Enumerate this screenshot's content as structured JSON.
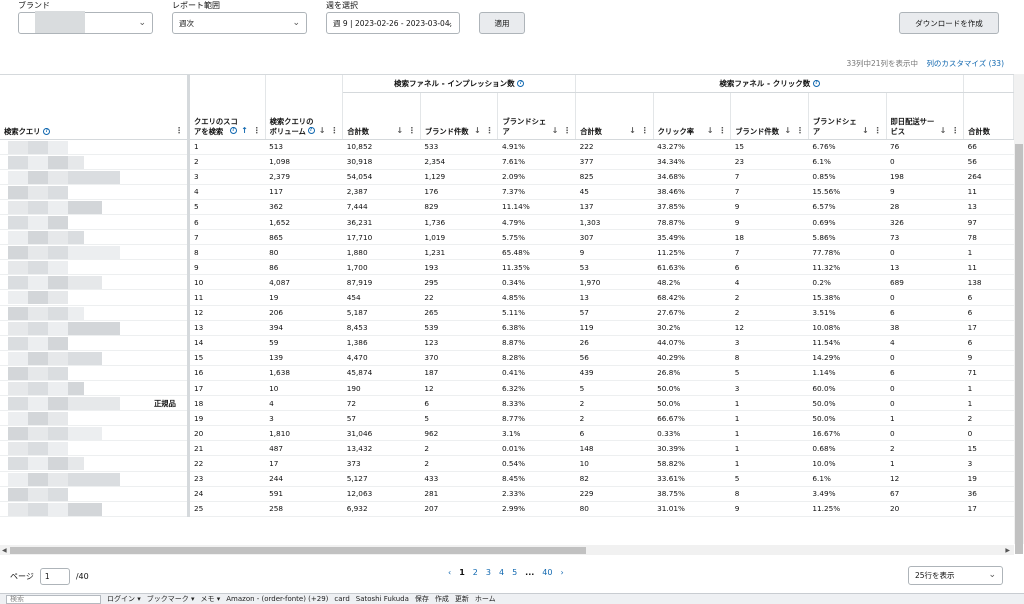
{
  "filters": {
    "brand_label": "ブランド",
    "report_range_label": "レポート範囲",
    "report_range_value": "週次",
    "week_label": "週を選択",
    "week_value": "週 9 | 2023-02-26 - 2023-03-04,",
    "apply_button": "適用",
    "download_button": "ダウンロードを作成"
  },
  "infobar": {
    "text": "33列中21列を表示中",
    "customize_link": "列のカスタマイズ (33)"
  },
  "table": {
    "group_headers": [
      "検索ファネル - インプレッション数",
      "検索ファネル - クリック数"
    ],
    "col_query": "検索クエリ",
    "col_score": "クエリのスコアを検索",
    "col_volume": "検索クエリのボリューム",
    "col_imp_total": "合計数",
    "col_imp_brand_count": "ブランド件数",
    "col_imp_brand_share": "ブランドシェア",
    "col_clk_total": "合計数",
    "col_clk_rate": "クリック率",
    "col_clk_brand_count": "ブランド件数",
    "col_clk_brand_share": "ブランドシェア",
    "col_sameday": "即日配送サービス",
    "col_total_next": "合計数",
    "tag_text": "正規品",
    "rows": [
      [
        "1",
        "513",
        "10,852",
        "533",
        "4.91%",
        "222",
        "43.27%",
        "15",
        "6.76%",
        "76",
        "66"
      ],
      [
        "2",
        "1,098",
        "30,918",
        "2,354",
        "7.61%",
        "377",
        "34.34%",
        "23",
        "6.1%",
        "0",
        "56"
      ],
      [
        "3",
        "2,379",
        "54,054",
        "1,129",
        "2.09%",
        "825",
        "34.68%",
        "7",
        "0.85%",
        "198",
        "264"
      ],
      [
        "4",
        "117",
        "2,387",
        "176",
        "7.37%",
        "45",
        "38.46%",
        "7",
        "15.56%",
        "9",
        "11"
      ],
      [
        "5",
        "362",
        "7,444",
        "829",
        "11.14%",
        "137",
        "37.85%",
        "9",
        "6.57%",
        "28",
        "13"
      ],
      [
        "6",
        "1,652",
        "36,231",
        "1,736",
        "4.79%",
        "1,303",
        "78.87%",
        "9",
        "0.69%",
        "326",
        "97"
      ],
      [
        "7",
        "865",
        "17,710",
        "1,019",
        "5.75%",
        "307",
        "35.49%",
        "18",
        "5.86%",
        "73",
        "78"
      ],
      [
        "8",
        "80",
        "1,880",
        "1,231",
        "65.48%",
        "9",
        "11.25%",
        "7",
        "77.78%",
        "0",
        "1"
      ],
      [
        "9",
        "86",
        "1,700",
        "193",
        "11.35%",
        "53",
        "61.63%",
        "6",
        "11.32%",
        "13",
        "11"
      ],
      [
        "10",
        "4,087",
        "87,919",
        "295",
        "0.34%",
        "1,970",
        "48.2%",
        "4",
        "0.2%",
        "689",
        "138"
      ],
      [
        "11",
        "19",
        "454",
        "22",
        "4.85%",
        "13",
        "68.42%",
        "2",
        "15.38%",
        "0",
        "6"
      ],
      [
        "12",
        "206",
        "5,187",
        "265",
        "5.11%",
        "57",
        "27.67%",
        "2",
        "3.51%",
        "6",
        "6"
      ],
      [
        "13",
        "394",
        "8,453",
        "539",
        "6.38%",
        "119",
        "30.2%",
        "12",
        "10.08%",
        "38",
        "17"
      ],
      [
        "14",
        "59",
        "1,386",
        "123",
        "8.87%",
        "26",
        "44.07%",
        "3",
        "11.54%",
        "4",
        "6"
      ],
      [
        "15",
        "139",
        "4,470",
        "370",
        "8.28%",
        "56",
        "40.29%",
        "8",
        "14.29%",
        "0",
        "9"
      ],
      [
        "16",
        "1,638",
        "45,874",
        "187",
        "0.41%",
        "439",
        "26.8%",
        "5",
        "1.14%",
        "6",
        "71"
      ],
      [
        "17",
        "10",
        "190",
        "12",
        "6.32%",
        "5",
        "50.0%",
        "3",
        "60.0%",
        "0",
        "1"
      ],
      [
        "18",
        "4",
        "72",
        "6",
        "8.33%",
        "2",
        "50.0%",
        "1",
        "50.0%",
        "0",
        "1"
      ],
      [
        "19",
        "3",
        "57",
        "5",
        "8.77%",
        "2",
        "66.67%",
        "1",
        "50.0%",
        "1",
        "2"
      ],
      [
        "20",
        "1,810",
        "31,046",
        "962",
        "3.1%",
        "6",
        "0.33%",
        "1",
        "16.67%",
        "0",
        "0"
      ],
      [
        "21",
        "487",
        "13,432",
        "2",
        "0.01%",
        "148",
        "30.39%",
        "1",
        "0.68%",
        "2",
        "15"
      ],
      [
        "22",
        "17",
        "373",
        "2",
        "0.54%",
        "10",
        "58.82%",
        "1",
        "10.0%",
        "1",
        "3"
      ],
      [
        "23",
        "244",
        "5,127",
        "433",
        "8.45%",
        "82",
        "33.61%",
        "5",
        "6.1%",
        "12",
        "19"
      ],
      [
        "24",
        "591",
        "12,063",
        "281",
        "2.33%",
        "229",
        "38.75%",
        "8",
        "3.49%",
        "67",
        "36"
      ],
      [
        "25",
        "258",
        "6,932",
        "207",
        "2.99%",
        "80",
        "31.01%",
        "9",
        "11.25%",
        "20",
        "17"
      ]
    ]
  },
  "pagination": {
    "page_label": "ページ",
    "page_value": "1",
    "total": "/40",
    "pages": [
      "1",
      "2",
      "3",
      "4",
      "5",
      "...",
      "40"
    ],
    "rows_per_page": "25行を表示"
  },
  "taskbar": {
    "search": "検索",
    "items": [
      "ログイン ▾",
      "ブックマーク ▾",
      "メモ ▾",
      "Amazon - (order-fonte) (+29)",
      "card",
      "Satoshi Fukuda",
      "保存",
      "作成",
      "更新",
      "ホーム"
    ]
  },
  "colors": {
    "link": "#1168b0",
    "header_border": "#d5d9dc"
  }
}
